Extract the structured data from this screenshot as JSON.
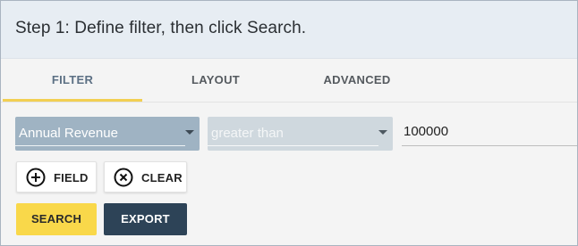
{
  "header": {
    "title": "Step 1: Define filter, then click Search."
  },
  "tabs": [
    {
      "label": "FILTER",
      "active": true
    },
    {
      "label": "LAYOUT",
      "active": false
    },
    {
      "label": "ADVANCED",
      "active": false
    }
  ],
  "filter": {
    "field": {
      "value": "Annual Revenue",
      "icon": "chevron-down-icon"
    },
    "operator": {
      "value": "greater than",
      "icon": "chevron-down-icon"
    },
    "value": "100000"
  },
  "buttons": {
    "field": {
      "label": "FIELD",
      "icon": "plus-circle-icon"
    },
    "clear": {
      "label": "CLEAR",
      "icon": "x-circle-icon"
    },
    "search": {
      "label": "SEARCH"
    },
    "export": {
      "label": "EXPORT"
    }
  },
  "colors": {
    "header_bg": "#e7edf3",
    "active_tab_underline": "#f2cf52",
    "field_select_bg": "#9fb3c3",
    "operator_select_bg": "#cfd8de",
    "search_button": "#f9d84a",
    "export_button": "#2d4357"
  }
}
